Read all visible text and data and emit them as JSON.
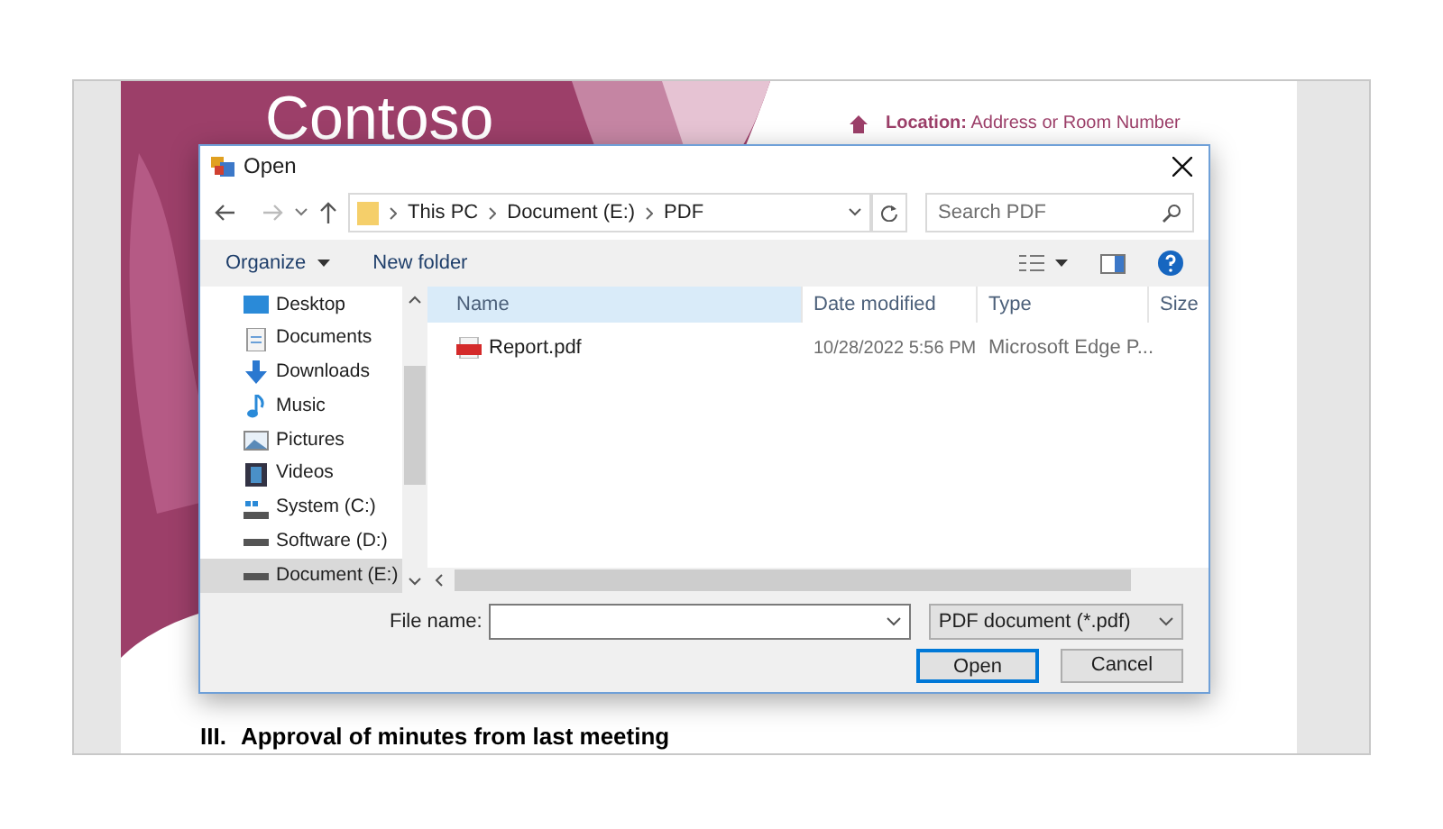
{
  "document": {
    "logo": "Contoso",
    "meta": [
      {
        "label": "Location:",
        "value": "Address or Room Number"
      }
    ],
    "heading": {
      "number": "III.",
      "text": "Approval of minutes from last meeting"
    }
  },
  "dialog": {
    "title": "Open",
    "breadcrumb": [
      "This PC",
      "Document (E:)",
      "PDF"
    ],
    "search": {
      "placeholder": "Search PDF"
    },
    "toolbar": [
      "Organize",
      "New folder"
    ],
    "nav_items": [
      {
        "label": "Desktop",
        "kind": "desktop",
        "selected": false
      },
      {
        "label": "Documents",
        "kind": "documents",
        "selected": false
      },
      {
        "label": "Downloads",
        "kind": "downloads",
        "selected": false
      },
      {
        "label": "Music",
        "kind": "music",
        "selected": false
      },
      {
        "label": "Pictures",
        "kind": "pictures",
        "selected": false
      },
      {
        "label": "Videos",
        "kind": "videos",
        "selected": false
      },
      {
        "label": "System (C:)",
        "kind": "system-drive",
        "selected": false
      },
      {
        "label": "Software (D:)",
        "kind": "drive",
        "selected": false
      },
      {
        "label": "Document (E:)",
        "kind": "drive",
        "selected": true
      }
    ],
    "columns": [
      "Name",
      "Date modified",
      "Type",
      "Size"
    ],
    "files": [
      {
        "name": "Report.pdf",
        "date": "10/28/2022 5:56 PM",
        "type": "Microsoft Edge P..."
      }
    ],
    "file_name_label": "File name:",
    "file_type": "PDF document (*.pdf)",
    "buttons": [
      {
        "label": "Open",
        "default": true
      },
      {
        "label": "Cancel",
        "default": false
      }
    ]
  }
}
